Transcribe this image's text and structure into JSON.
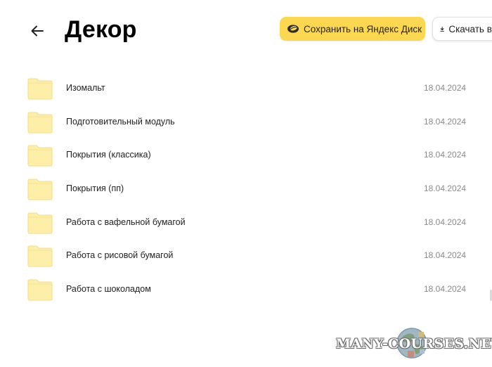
{
  "header": {
    "title": "Декор",
    "back_icon": "arrow-left-icon",
    "save_button_label": "Сохранить на Яндекс Диск",
    "save_button_icon": "yandex-disk-icon",
    "download_button_label": "Скачать все",
    "download_button_icon": "download-icon"
  },
  "files": [
    {
      "name": "Изомальт",
      "date": "18.04.2024",
      "icon": "folder-icon"
    },
    {
      "name": "Подготовительный модуль",
      "date": "18.04.2024",
      "icon": "folder-icon"
    },
    {
      "name": "Покрытия (классика)",
      "date": "18.04.2024",
      "icon": "folder-icon"
    },
    {
      "name": "Покрытия (пп)",
      "date": "18.04.2024",
      "icon": "folder-icon"
    },
    {
      "name": "Работа с вафельной бумагой",
      "date": "18.04.2024",
      "icon": "folder-icon"
    },
    {
      "name": "Работа с рисовой бумагой",
      "date": "18.04.2024",
      "icon": "folder-icon"
    },
    {
      "name": "Работа с шоколадом",
      "date": "18.04.2024",
      "icon": "folder-icon"
    }
  ],
  "watermark": {
    "text": "MANY-COURSES.NET"
  },
  "colors": {
    "save_button_bg": "#fbd84f",
    "folder_fill": "#fdeea8",
    "date_text": "#8a8a8a"
  }
}
